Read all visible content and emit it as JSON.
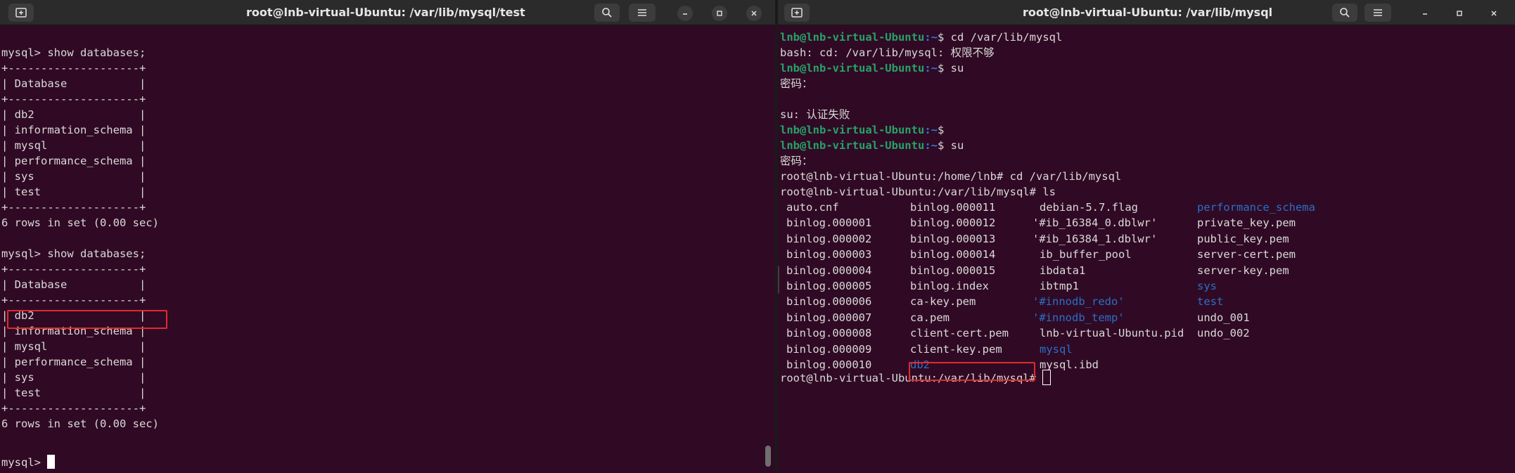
{
  "left_window": {
    "title": "root@lnb-virtual-Ubuntu: /var/lib/mysql/test",
    "lines": [
      "mysql> show databases;",
      "+--------------------+",
      "| Database           |",
      "+--------------------+",
      "| db2                |",
      "| information_schema |",
      "| mysql              |",
      "| performance_schema |",
      "| sys                |",
      "| test               |",
      "+--------------------+",
      "6 rows in set (0.00 sec)",
      "",
      "mysql> show databases;",
      "+--------------------+",
      "| Database           |",
      "+--------------------+",
      "| db2                |",
      "| information_schema |",
      "| mysql              |",
      "| performance_schema |",
      "| sys                |",
      "| test               |",
      "+--------------------+",
      "6 rows in set (0.00 sec)",
      "",
      "mysql> "
    ]
  },
  "right_window": {
    "title": "root@lnb-virtual-Ubuntu: /var/lib/mysql",
    "session": [
      {
        "user": "lnb@lnb-virtual-Ubuntu",
        "path": ":~",
        "rest": "$ cd /var/lib/mysql"
      },
      {
        "text": "bash: cd: /var/lib/mysql: 权限不够"
      },
      {
        "user": "lnb@lnb-virtual-Ubuntu",
        "path": ":~",
        "rest": "$ su"
      },
      {
        "text": "密码："
      },
      {
        "text": ""
      },
      {
        "text": "su: 认证失败"
      },
      {
        "user": "lnb@lnb-virtual-Ubuntu",
        "path": ":~",
        "rest": "$"
      },
      {
        "user": "lnb@lnb-virtual-Ubuntu",
        "path": ":~",
        "rest": "$ su"
      },
      {
        "text": "密码："
      },
      {
        "text": "root@lnb-virtual-Ubuntu:/home/lnb# cd /var/lib/mysql"
      },
      {
        "text": "root@lnb-virtual-Ubuntu:/var/lib/mysql# ls"
      }
    ],
    "ls_columns": [
      [
        "auto.cnf",
        "binlog.000001",
        "binlog.000002",
        "binlog.000003",
        "binlog.000004",
        "binlog.000005",
        "binlog.000006",
        "binlog.000007",
        "binlog.000008",
        "binlog.000009",
        "binlog.000010"
      ],
      [
        "binlog.000011",
        "binlog.000012",
        "binlog.000013",
        "binlog.000014",
        "binlog.000015",
        "binlog.index",
        "ca-key.pem",
        "ca.pem",
        "client-cert.pem",
        "client-key.pem",
        "db2"
      ],
      [
        "debian-5.7.flag",
        "'#ib_16384_0.dblwr'",
        "'#ib_16384_1.dblwr'",
        "ib_buffer_pool",
        "ibdata1",
        "ibtmp1",
        "'#innodb_redo'",
        "'#innodb_temp'",
        "lnb-virtual-Ubuntu.pid",
        "mysql",
        "mysql.ibd"
      ],
      [
        "performance_schema",
        "private_key.pem",
        "public_key.pem",
        "server-cert.pem",
        "server-key.pem",
        "sys",
        "test",
        "undo_001",
        "undo_002"
      ]
    ],
    "ls_directories": [
      "db2",
      "'#innodb_redo'",
      "'#innodb_temp'",
      "mysql",
      "performance_schema",
      "sys",
      "test"
    ],
    "final_prompt": "root@lnb-virtual-Ubuntu:/var/lib/mysql# "
  },
  "colors": {
    "terminal_bg": "#300a24",
    "titlebar_bg": "#2b2b2b",
    "prompt_user": "#26a269",
    "prompt_path": "#2a7bde",
    "directory": "#2a6fc9",
    "highlight_box": "#e02b2b"
  },
  "icons": {
    "new_tab": "new-tab-icon",
    "search": "search-icon",
    "menu": "hamburger-menu-icon",
    "minimize": "minimize-icon",
    "maximize": "maximize-icon",
    "close": "close-icon"
  }
}
